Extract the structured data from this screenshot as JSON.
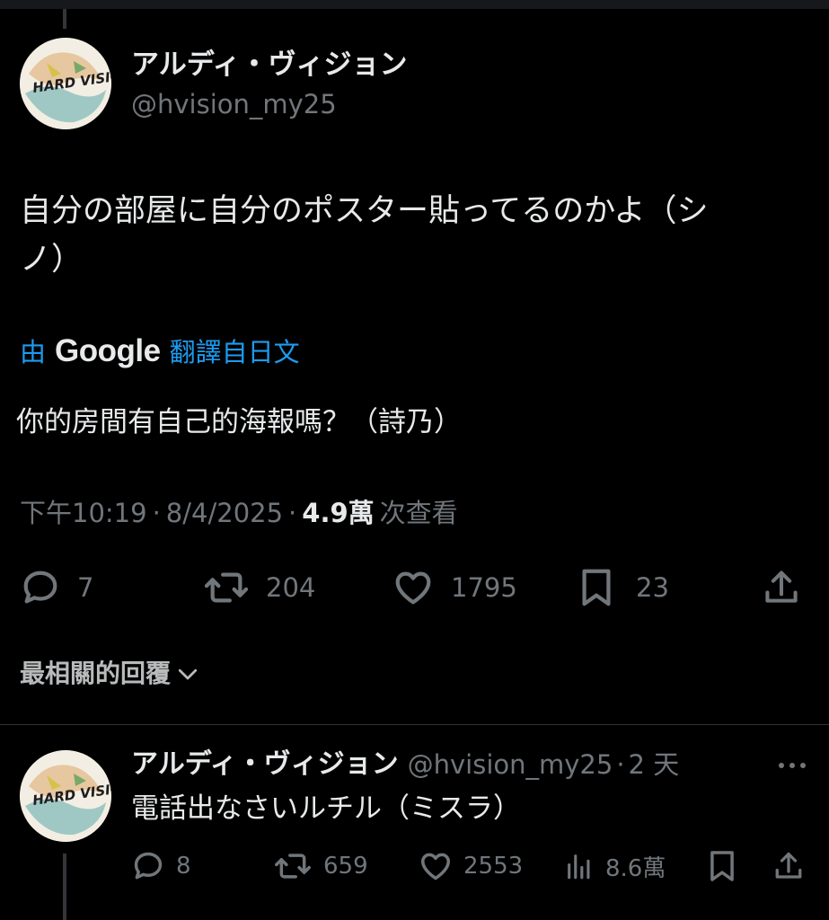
{
  "tweet": {
    "display_name": "アルディ・ヴィジョン",
    "handle": "@hvision_my25",
    "avatar_text": "HARD VISION",
    "text_line1": "自分の部屋に自分のポスター貼ってるのかよ（シ",
    "text_line2": "ノ）",
    "translation_prefix": "由",
    "translation_brand": "Google",
    "translation_suffix": "翻譯自日文",
    "translated_text": "你的房間有自己的海報嗎？（詩乃）",
    "time": "下午10:19",
    "date": "8/4/2025",
    "views_count": "4.9萬",
    "views_label": "次查看",
    "separator": "·",
    "replies": "7",
    "retweets": "204",
    "likes": "1795",
    "bookmarks": "23"
  },
  "sort": {
    "label": "最相關的回覆",
    "icon": "chevron-down-icon"
  },
  "reply": {
    "display_name": "アルディ・ヴィジョン",
    "handle": "@hvision_my25",
    "separator": "·",
    "time_ago": "2 天",
    "avatar_text": "HARD VISION",
    "text": "電話出なさいルチル（ミスラ）",
    "replies": "8",
    "retweets": "659",
    "likes": "2553",
    "views": "8.6萬"
  },
  "colors": {
    "background": "#000000",
    "text": "#e7e9ea",
    "muted": "#71767b",
    "accent": "#1d9bf0"
  }
}
